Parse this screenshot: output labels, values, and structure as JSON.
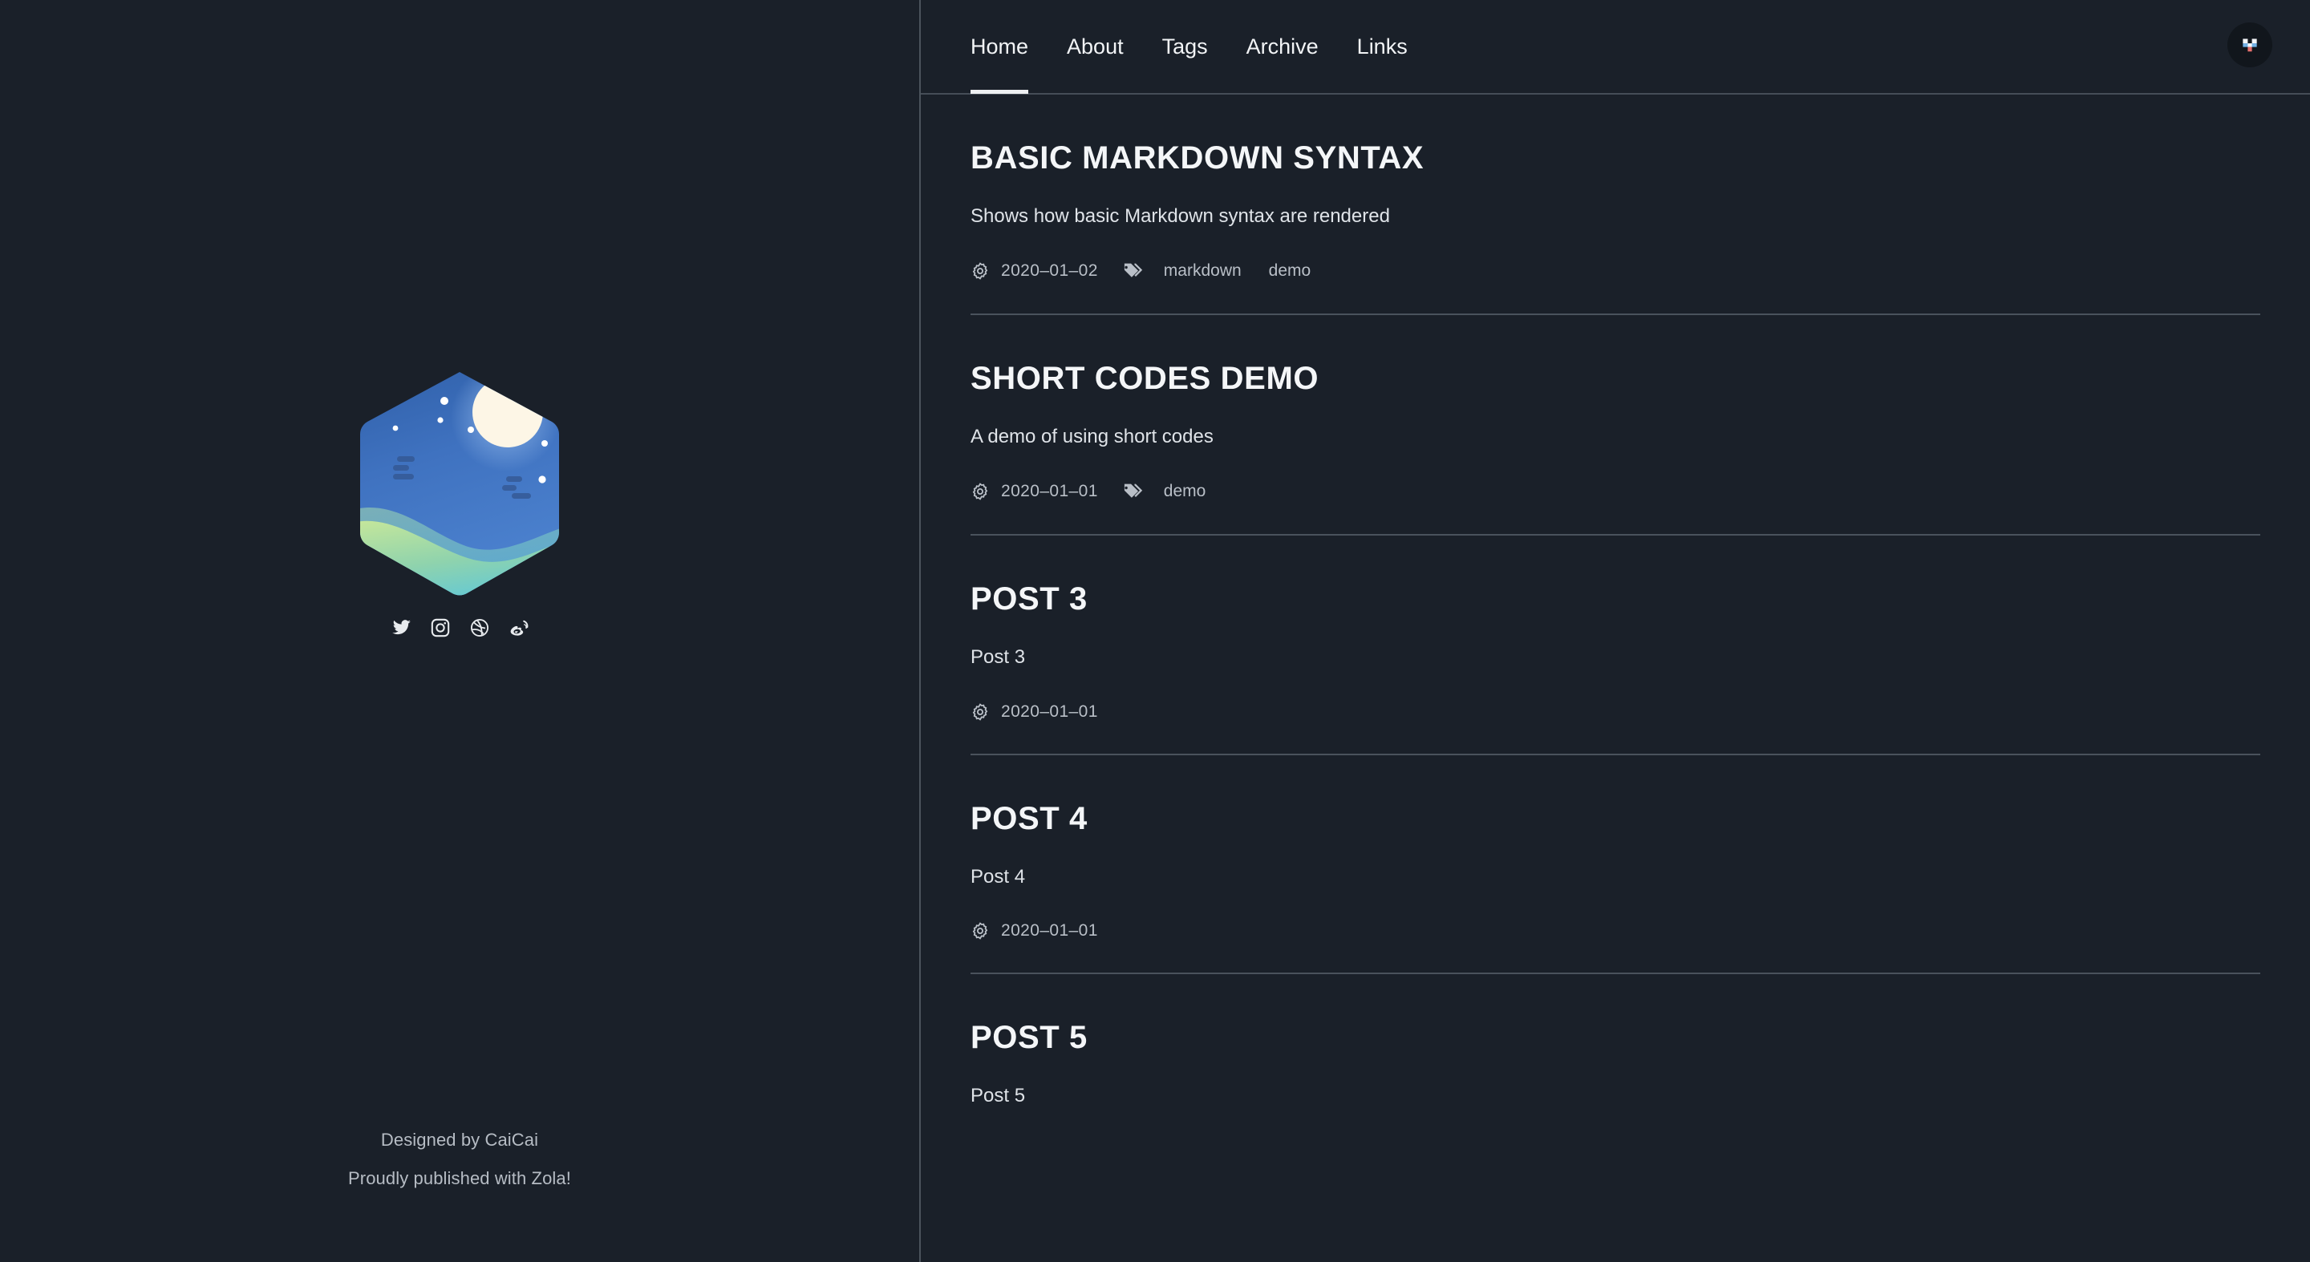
{
  "site": {
    "logo_alt": "hexagon-night-scene-logo",
    "avatar_alt": "blocky-pixel-logo-avatar"
  },
  "nav": {
    "items": [
      {
        "label": "Home",
        "active": true
      },
      {
        "label": "About",
        "active": false
      },
      {
        "label": "Tags",
        "active": false
      },
      {
        "label": "Archive",
        "active": false
      },
      {
        "label": "Links",
        "active": false
      }
    ]
  },
  "social": {
    "items": [
      {
        "name": "twitter-icon"
      },
      {
        "name": "instagram-icon"
      },
      {
        "name": "dribbble-icon"
      },
      {
        "name": "weibo-icon"
      }
    ]
  },
  "footer": {
    "designed_by": "Designed by CaiCai",
    "published_with": "Proudly published with Zola!"
  },
  "posts": [
    {
      "title": "BASIC MARKDOWN SYNTAX",
      "description": "Shows how basic Markdown syntax are rendered",
      "date": "2020–01–02",
      "tags": [
        "markdown",
        "demo"
      ]
    },
    {
      "title": "SHORT CODES DEMO",
      "description": "A demo of using short codes",
      "date": "2020–01–01",
      "tags": [
        "demo"
      ]
    },
    {
      "title": "POST 3",
      "description": "Post 3",
      "date": "2020–01–01",
      "tags": []
    },
    {
      "title": "POST 4",
      "description": "Post 4",
      "date": "2020–01–01",
      "tags": []
    },
    {
      "title": "POST 5",
      "description": "Post 5",
      "date": "",
      "tags": []
    }
  ],
  "colors": {
    "background": "#1a2029",
    "divider": "#4a525c",
    "text_primary": "#f4f6f8",
    "text_secondary": "#b9bfc7",
    "accent_underline": "#eef0f2"
  }
}
